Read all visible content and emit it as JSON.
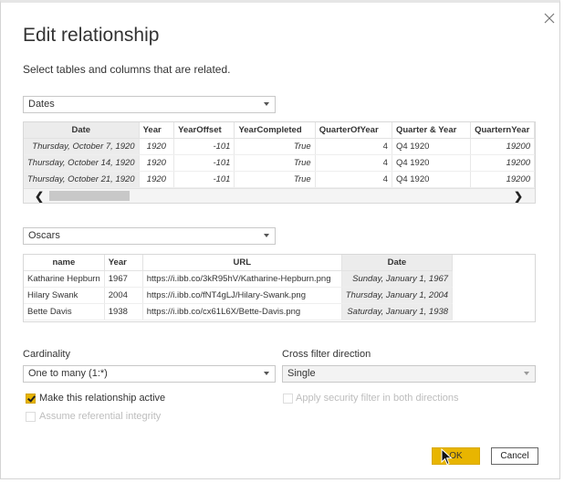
{
  "dialog": {
    "title": "Edit relationship",
    "subtitle": "Select tables and columns that are related."
  },
  "table1": {
    "selected": "Dates",
    "columns": [
      "Date",
      "Year",
      "YearOffset",
      "YearCompleted",
      "QuarterOfYear",
      "Quarter & Year",
      "QuarternYear"
    ],
    "rows": [
      [
        "Thursday, October 7, 1920",
        "1920",
        "-101",
        "True",
        "4",
        "Q4 1920",
        "19200"
      ],
      [
        "Thursday, October 14, 1920",
        "1920",
        "-101",
        "True",
        "4",
        "Q4 1920",
        "19200"
      ],
      [
        "Thursday, October 21, 1920",
        "1920",
        "-101",
        "True",
        "4",
        "Q4 1920",
        "19200"
      ]
    ],
    "selected_column": "Date"
  },
  "table2": {
    "selected": "Oscars",
    "columns": [
      "name",
      "Year",
      "URL",
      "Date"
    ],
    "rows": [
      [
        "Katharine Hepburn",
        "1967",
        "https://i.ibb.co/3kR95hV/Katharine-Hepburn.png",
        "Sunday, January 1, 1967"
      ],
      [
        "Hilary Swank",
        "2004",
        "https://i.ibb.co/fNT4gLJ/Hilary-Swank.png",
        "Thursday, January 1, 2004"
      ],
      [
        "Bette Davis",
        "1938",
        "https://i.ibb.co/cx61L6X/Bette-Davis.png",
        "Saturday, January 1, 1938"
      ]
    ],
    "selected_column": "Date"
  },
  "options": {
    "cardinality_label": "Cardinality",
    "cardinality_value": "One to many (1:*)",
    "cross_filter_label": "Cross filter direction",
    "cross_filter_value": "Single",
    "make_active_label": "Make this relationship active",
    "make_active_checked": true,
    "security_filter_label": "Apply security filter in both directions",
    "referential_integrity_label": "Assume referential integrity"
  },
  "buttons": {
    "ok": "OK",
    "cancel": "Cancel"
  },
  "colors": {
    "accent": "#e8b500",
    "selected_column_bg": "#ececec"
  },
  "icons": {
    "close": "close-icon",
    "dropdown": "chevron-down-icon",
    "scroll_left": "chevron-left-icon",
    "scroll_right": "chevron-right-icon",
    "cursor": "mouse-pointer-icon"
  }
}
